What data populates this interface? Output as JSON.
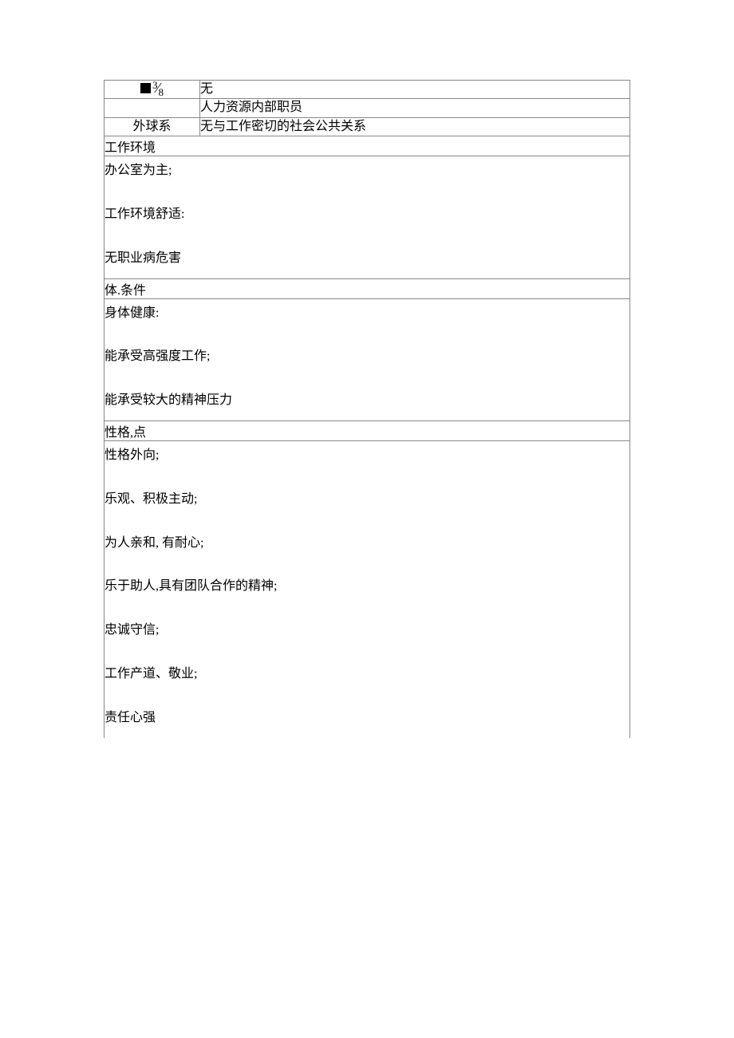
{
  "rows": {
    "r1_label_num": "3",
    "r1_label_den": "8",
    "r1_value": "无",
    "r2_label": "",
    "r2_value": "人力资源内部职员",
    "r3_label": "外球系",
    "r3_value": "无与工作密切的社会公共关系"
  },
  "sections": {
    "env": {
      "header": "工作环境",
      "lines": [
        "办公室为主;",
        "工作环境舒适:",
        "无职业病危害"
      ]
    },
    "body": {
      "header": "体.条件",
      "lines": [
        "身体健康:",
        "能承受高强度工作;",
        "能承受较大的精神压力"
      ]
    },
    "char": {
      "header": "性格,点",
      "lines": [
        "性格外向;",
        "乐观、积极主动;",
        "为人亲和,  有耐心;",
        "乐于助人,具有团队合作的精神;",
        "忠诚守信;",
        "工作产道、敬业;",
        "责任心强"
      ]
    }
  }
}
